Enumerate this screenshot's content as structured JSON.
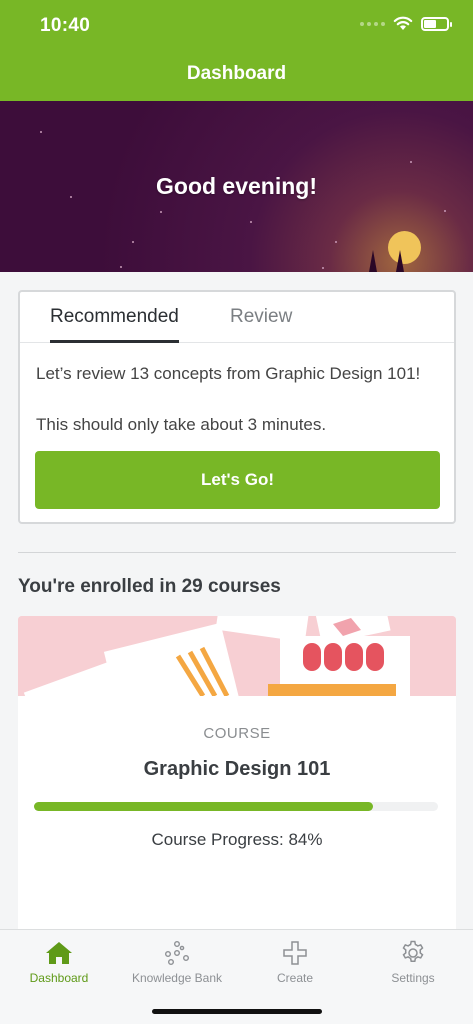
{
  "status": {
    "time": "10:40"
  },
  "header": {
    "title": "Dashboard"
  },
  "hero": {
    "greeting": "Good evening!"
  },
  "recommended": {
    "tabs": [
      {
        "label": "Recommended"
      },
      {
        "label": "Review"
      }
    ],
    "line1": "Let’s review 13 concepts from Graphic Design 101!",
    "line2": "This should only take about 3 minutes.",
    "button_label": "Let's Go!"
  },
  "enrolled_text": "You're enrolled in 29 courses",
  "course": {
    "type": "COURSE",
    "title": "Graphic Design 101",
    "progress_percent": 84,
    "progress_label": "Course Progress: 84%"
  },
  "bottom_nav": {
    "items": [
      {
        "label": "Dashboard",
        "icon": "home-icon"
      },
      {
        "label": "Knowledge Bank",
        "icon": "dots-cluster-icon"
      },
      {
        "label": "Create",
        "icon": "plus-icon"
      },
      {
        "label": "Settings",
        "icon": "gear-icon"
      }
    ]
  },
  "colors": {
    "brand_green": "#78b726",
    "hero_purple": "#3d0d3a",
    "moon": "#f0c45a"
  }
}
